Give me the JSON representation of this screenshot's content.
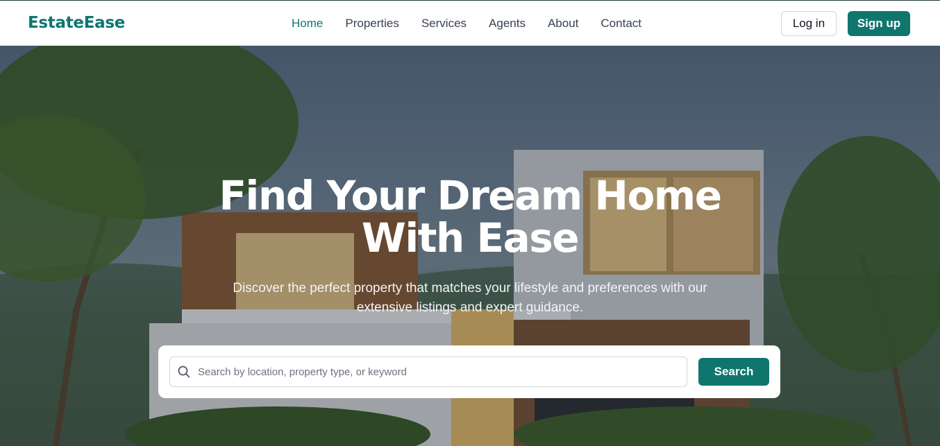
{
  "brand": {
    "name": "EstateEase",
    "accent_color": "#0f766e"
  },
  "nav": {
    "items": [
      {
        "label": "Home",
        "active": true
      },
      {
        "label": "Properties",
        "active": false
      },
      {
        "label": "Services",
        "active": false
      },
      {
        "label": "Agents",
        "active": false
      },
      {
        "label": "About",
        "active": false
      },
      {
        "label": "Contact",
        "active": false
      }
    ]
  },
  "auth": {
    "login_label": "Log in",
    "signup_label": "Sign up"
  },
  "hero": {
    "title": "Find Your Dream Home With Ease",
    "subtitle": "Discover the perfect property that matches your lifestyle and preferences with our extensive listings and expert guidance.",
    "background_icon": "modern-house-photo"
  },
  "search": {
    "placeholder": "Search by location, property type, or keyword",
    "value": "",
    "button_label": "Search",
    "icon": "search-icon"
  }
}
